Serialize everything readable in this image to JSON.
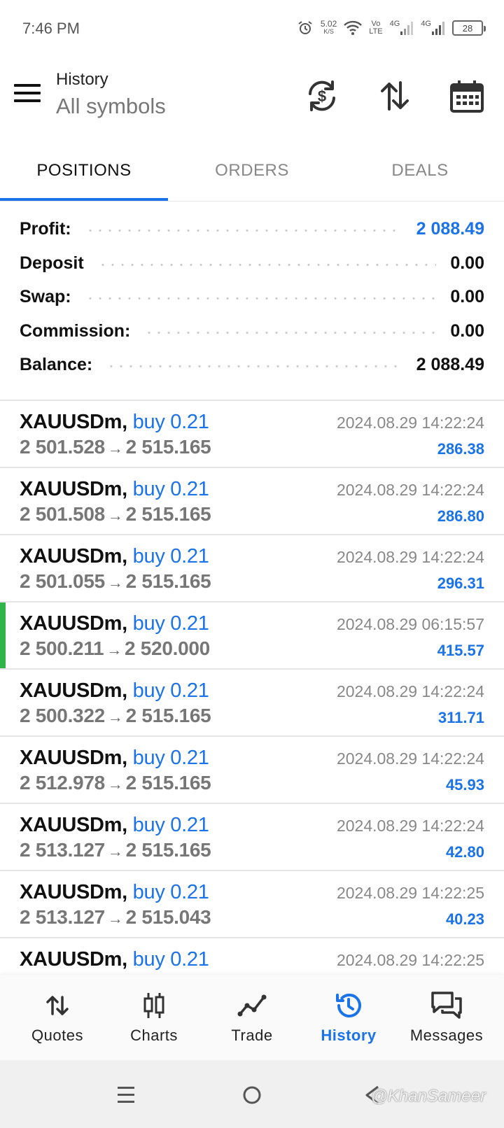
{
  "status_bar": {
    "time": "7:46 PM",
    "net_speed": "5.02",
    "net_speed_unit": "K/S",
    "volte_top": "Vo",
    "volte_bottom": "LTE",
    "sim1_tech": "4G",
    "sim2_tech": "4G",
    "battery_level": "28"
  },
  "header": {
    "title": "History",
    "subtitle": "All symbols"
  },
  "tabs": [
    {
      "label": "POSITIONS",
      "active": true
    },
    {
      "label": "ORDERS",
      "active": false
    },
    {
      "label": "DEALS",
      "active": false
    }
  ],
  "summary": {
    "profit_label": "Profit:",
    "profit_value": "2 088.49",
    "deposit_label": "Deposit",
    "deposit_value": "0.00",
    "swap_label": "Swap:",
    "swap_value": "0.00",
    "commission_label": "Commission:",
    "commission_value": "0.00",
    "balance_label": "Balance:",
    "balance_value": "2 088.49"
  },
  "arrow_glyph": "→",
  "positions": [
    {
      "symbol": "XAUUSDm,",
      "side": "buy 0.21",
      "open_price": "2 501.528",
      "close_price": "2 515.165",
      "time": "2024.08.29 14:22:24",
      "profit": "286.38"
    },
    {
      "symbol": "XAUUSDm,",
      "side": "buy 0.21",
      "open_price": "2 501.508",
      "close_price": "2 515.165",
      "time": "2024.08.29 14:22:24",
      "profit": "286.80"
    },
    {
      "symbol": "XAUUSDm,",
      "side": "buy 0.21",
      "open_price": "2 501.055",
      "close_price": "2 515.165",
      "time": "2024.08.29 14:22:24",
      "profit": "296.31"
    },
    {
      "symbol": "XAUUSDm,",
      "side": "buy 0.21",
      "open_price": "2 500.211",
      "close_price": "2 520.000",
      "time": "2024.08.29 06:15:57",
      "profit": "415.57",
      "highlight_color": "#2fb34a"
    },
    {
      "symbol": "XAUUSDm,",
      "side": "buy 0.21",
      "open_price": "2 500.322",
      "close_price": "2 515.165",
      "time": "2024.08.29 14:22:24",
      "profit": "311.71"
    },
    {
      "symbol": "XAUUSDm,",
      "side": "buy 0.21",
      "open_price": "2 512.978",
      "close_price": "2 515.165",
      "time": "2024.08.29 14:22:24",
      "profit": "45.93"
    },
    {
      "symbol": "XAUUSDm,",
      "side": "buy 0.21",
      "open_price": "2 513.127",
      "close_price": "2 515.165",
      "time": "2024.08.29 14:22:24",
      "profit": "42.80"
    },
    {
      "symbol": "XAUUSDm,",
      "side": "buy 0.21",
      "open_price": "2 513.127",
      "close_price": "2 515.043",
      "time": "2024.08.29 14:22:25",
      "profit": "40.23"
    },
    {
      "symbol": "XAUUSDm,",
      "side": "buy 0.21",
      "open_price": "",
      "close_price": "",
      "time": "2024.08.29 14:22:25",
      "profit": ""
    }
  ],
  "bottom_nav": [
    {
      "label": "Quotes",
      "icon": "quotes-arrows-icon",
      "active": false
    },
    {
      "label": "Charts",
      "icon": "candlestick-icon",
      "active": false
    },
    {
      "label": "Trade",
      "icon": "trade-line-icon",
      "active": false
    },
    {
      "label": "History",
      "icon": "history-clock-icon",
      "active": true
    },
    {
      "label": "Messages",
      "icon": "chat-bubbles-icon",
      "active": false
    }
  ],
  "watermark": "@KhanSameer",
  "colors": {
    "accent": "#1a73e8",
    "highlight_marker": "#2fb34a",
    "secondary_text": "#777777"
  }
}
